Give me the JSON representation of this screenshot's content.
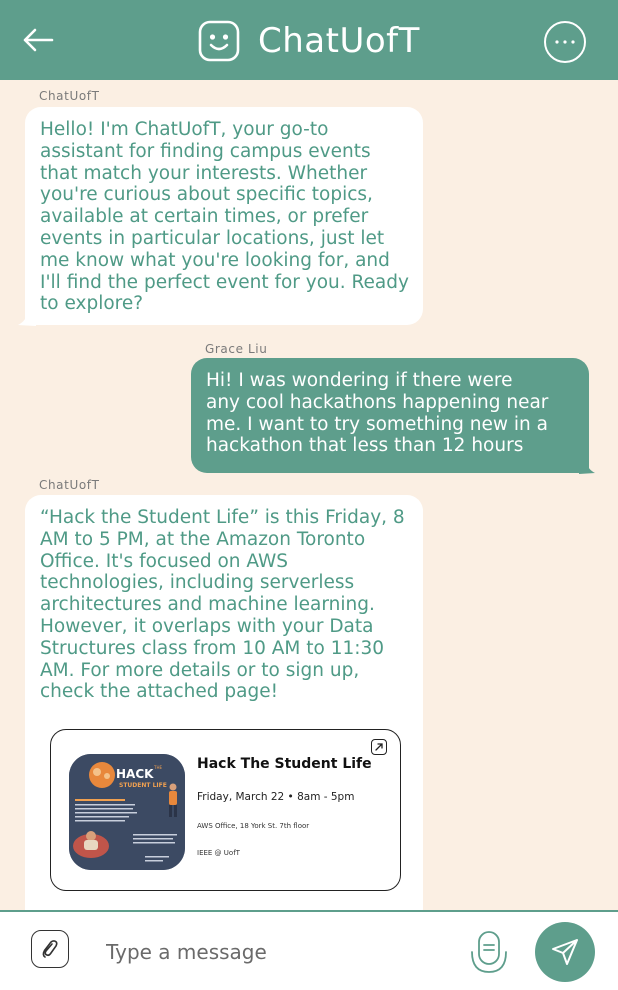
{
  "header": {
    "title": "ChatUofT",
    "back_icon": "arrow-left-icon",
    "logo_icon": "smiley-face-icon",
    "more_icon": "more-dots-icon"
  },
  "messages": [
    {
      "sender": "ChatUofT",
      "role": "bot",
      "lines": [
        "Hello! I'm ChatUofT, your go-to",
        "assistant for finding campus events",
        "that match your interests. Whether",
        "you're curious about specific topics,",
        "available at certain times, or prefer",
        "events in particular locations, just let",
        "me know what you're looking for, and",
        "I'll find the perfect event for you. Ready",
        "to explore?"
      ]
    },
    {
      "sender": "Grace Liu",
      "role": "user",
      "lines": [
        "Hi! I was wondering if there were",
        "any cool hackathons happening near",
        "me. I want to try something new in a",
        "hackathon that less than 12 hours"
      ]
    },
    {
      "sender": "ChatUofT",
      "role": "bot",
      "lines": [
        "“Hack the Student Life” is this Friday, 8",
        "AM to 5 PM, at the Amazon Toronto",
        "Office. It's focused on AWS",
        "technologies, including serverless",
        "architectures and machine learning.",
        "However, it overlaps with your Data",
        "Structures class from 10 AM to 11:30",
        "AM. For more details or to sign up,",
        "check the attached page!"
      ]
    }
  ],
  "event_card": {
    "title": "Hack The Student Life",
    "date": "Friday, March 22 • 8am - 5pm",
    "location": "AWS Office, 18 York St. 7th floor",
    "organizer": "IEEE @ UofT",
    "thumb_title": "HACK",
    "thumb_subtitle": "STUDENT LIFE",
    "thumb_the": "THE",
    "open_icon": "external-link-icon"
  },
  "composer": {
    "placeholder": "Type a message",
    "attach_icon": "paperclip-icon",
    "mic_icon": "microphone-icon",
    "send_icon": "send-icon"
  },
  "colors": {
    "primary": "#5e9e8c",
    "background": "#fbefe3",
    "bot_text": "#4f9a86"
  }
}
